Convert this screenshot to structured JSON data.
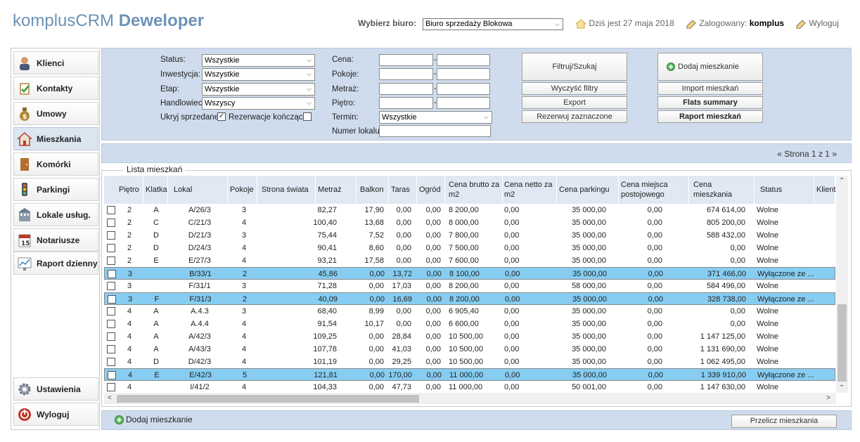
{
  "header": {
    "logo_plain": "komplusCRM",
    "logo_bold": "Deweloper",
    "office_label": "Wybierz biuro:",
    "office_value": "Biuro sprzedaży Blokowa",
    "date_text": "Dziś jest 27 maja 2018",
    "logged_label": "Zalogowany:",
    "logged_user": "komplus",
    "logout": "Wyloguj"
  },
  "sidebar": {
    "items": [
      {
        "label": "Klienci",
        "icon": "person-icon"
      },
      {
        "label": "Kontakty",
        "icon": "clipboard-icon"
      },
      {
        "label": "Umowy",
        "icon": "money-bag-icon"
      },
      {
        "label": "Mieszkania",
        "icon": "house-icon"
      },
      {
        "label": "Komórki",
        "icon": "door-icon"
      },
      {
        "label": "Parkingi",
        "icon": "traffic-light-icon"
      },
      {
        "label": "Lokale usług.",
        "icon": "building-icon"
      },
      {
        "label": "Notariusze",
        "icon": "calendar-icon"
      },
      {
        "label": "Raport dzienny",
        "icon": "chart-icon"
      }
    ],
    "settings": "Ustawienia",
    "logout": "Wyloguj"
  },
  "filters": {
    "status_label": "Status:",
    "status_value": "Wszystkie",
    "investment_label": "Inwestycja:",
    "investment_value": "Wszystkie",
    "stage_label": "Etap:",
    "stage_value": "Wszystkie",
    "seller_label": "Handlowiec:",
    "seller_value": "Wszyscy",
    "hide_sold": "Ukryj sprzedane",
    "reservations": "Rezerwacje kończące",
    "price_label": "Cena:",
    "rooms_label": "Pokoje:",
    "area_label": "Metraż:",
    "floor_label": "Piętro:",
    "term_label": "Termin:",
    "term_value": "Wszystkie",
    "unit_label": "Numer lokalu:",
    "dash": "-"
  },
  "buttons": {
    "filter": "Filtruj/Szukaj",
    "clear": "Wyczyść filtry",
    "export": "Export",
    "reserve": "Rezerwuj zaznaczone",
    "add_flat": "Dodaj mieszkanie",
    "import": "Import mieszkań",
    "summary": "Flats summary",
    "report": "Raport mieszkań",
    "recalc": "Przelicz mieszkania",
    "add_flat_bottom": "Dodaj mieszkanie"
  },
  "pager": {
    "text": "« Strona 1 z 1 »"
  },
  "list": {
    "title": "Lista mieszkań",
    "columns": [
      "Piętro",
      "Klatka",
      "Lokal",
      "Pokoje",
      "Strona świata",
      "Metraż",
      "Balkon",
      "Taras",
      "Ogród",
      "Cena brutto za m2",
      "Cena netto za m2",
      "Cena parkingu",
      "Cena miejsca postojowego",
      "Cena mieszkania",
      "Status",
      "Klient"
    ],
    "rows": [
      {
        "selected": false,
        "cells": [
          "2",
          "A",
          "A/26/3",
          "3",
          "",
          "82,27",
          "17,90",
          "0,00",
          "0,00",
          "8 200,00",
          "0,00",
          "35 000,00",
          "0,00",
          "674 614,00",
          "Wolne"
        ]
      },
      {
        "selected": false,
        "cells": [
          "2",
          "C",
          "C/21/3",
          "4",
          "",
          "100,40",
          "13,68",
          "0,00",
          "0,00",
          "8 000,00",
          "0,00",
          "35 000,00",
          "0,00",
          "805 200,00",
          "Wolne"
        ]
      },
      {
        "selected": false,
        "cells": [
          "2",
          "D",
          "D/21/3",
          "3",
          "",
          "75,44",
          "7,52",
          "0,00",
          "0,00",
          "7 800,00",
          "0,00",
          "35 000,00",
          "0,00",
          "588 432,00",
          "Wolne"
        ]
      },
      {
        "selected": false,
        "cells": [
          "2",
          "D",
          "D/24/3",
          "4",
          "",
          "90,41",
          "8,60",
          "0,00",
          "0,00",
          "7 500,00",
          "0,00",
          "35 000,00",
          "0,00",
          "0,00",
          "Wolne"
        ]
      },
      {
        "selected": false,
        "cells": [
          "2",
          "E",
          "E/27/3",
          "4",
          "",
          "93,21",
          "17,58",
          "0,00",
          "0,00",
          "7 600,00",
          "0,00",
          "35 000,00",
          "0,00",
          "0,00",
          "Wolne"
        ]
      },
      {
        "selected": true,
        "cells": [
          "3",
          "",
          "B/33/1",
          "2",
          "",
          "45,86",
          "0,00",
          "13,72",
          "0,00",
          "8 100,00",
          "0,00",
          "35 000,00",
          "0,00",
          "371 466,00",
          "Wyłączone ze ..."
        ]
      },
      {
        "selected": false,
        "cells": [
          "3",
          "",
          "F/31/1",
          "3",
          "",
          "71,28",
          "0,00",
          "17,03",
          "0,00",
          "8 200,00",
          "0,00",
          "58 000,00",
          "0,00",
          "584 496,00",
          "Wolne"
        ]
      },
      {
        "selected": true,
        "cells": [
          "3",
          "F",
          "F/31/3",
          "2",
          "",
          "40,09",
          "0,00",
          "16,69",
          "0,00",
          "8 200,00",
          "0,00",
          "35 000,00",
          "0,00",
          "328 738,00",
          "Wyłączone ze ..."
        ]
      },
      {
        "selected": false,
        "cells": [
          "4",
          "A",
          "A.4.3",
          "3",
          "",
          "68,40",
          "8,99",
          "0,00",
          "0,00",
          "6 905,40",
          "0,00",
          "35 000,00",
          "0,00",
          "0,00",
          "Wolne"
        ]
      },
      {
        "selected": false,
        "cells": [
          "4",
          "A",
          "A.4.4",
          "4",
          "",
          "91,54",
          "10,17",
          "0,00",
          "0,00",
          "6 600,00",
          "0,00",
          "35 000,00",
          "0,00",
          "0,00",
          "Wolne"
        ]
      },
      {
        "selected": false,
        "cells": [
          "4",
          "A",
          "A/42/3",
          "4",
          "",
          "109,25",
          "0,00",
          "28,84",
          "0,00",
          "10 500,00",
          "0,00",
          "35 000,00",
          "0,00",
          "1 147 125,00",
          "Wolne"
        ]
      },
      {
        "selected": false,
        "cells": [
          "4",
          "A",
          "A/43/3",
          "4",
          "",
          "107,78",
          "0,00",
          "41,03",
          "0,00",
          "10 500,00",
          "0,00",
          "35 000,00",
          "0,00",
          "1 131 690,00",
          "Wolne"
        ]
      },
      {
        "selected": false,
        "cells": [
          "4",
          "D",
          "D/42/3",
          "4",
          "",
          "101,19",
          "0,00",
          "29,25",
          "0,00",
          "10 500,00",
          "0,00",
          "35 000,00",
          "0,00",
          "1 062 495,00",
          "Wolne"
        ]
      },
      {
        "selected": true,
        "cells": [
          "4",
          "E",
          "E/42/3",
          "5",
          "",
          "121,81",
          "0,00",
          "170,00",
          "0,00",
          "11 000,00",
          "0,00",
          "35 000,00",
          "0,00",
          "1 339 910,00",
          "Wyłączone ze ..."
        ]
      },
      {
        "selected": false,
        "cells": [
          "4",
          "",
          "I/41/2",
          "4",
          "",
          "104,33",
          "0,00",
          "47,73",
          "0,00",
          "11 000,00",
          "0,00",
          "50 001,00",
          "0,00",
          "1 147 630,00",
          "Wolne"
        ]
      }
    ]
  },
  "colors": {
    "accent": "#6d93b5",
    "panel": "#cfdced",
    "selected_row": "#87cdf2"
  }
}
